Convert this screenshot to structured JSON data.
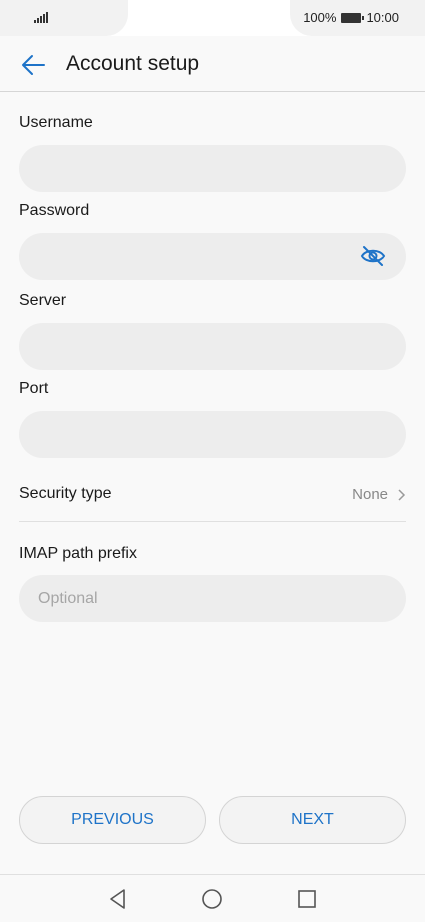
{
  "status_bar": {
    "battery": "100%",
    "time": "10:00"
  },
  "header": {
    "title": "Account setup",
    "back_icon": "arrow-left-icon"
  },
  "form": {
    "username_label": "Username",
    "username_value": "",
    "password_label": "Password",
    "password_value": "",
    "password_toggle_icon": "eye-off-icon",
    "server_label": "Server",
    "server_value": "",
    "port_label": "Port",
    "port_value": "",
    "security_label": "Security type",
    "security_value": "None",
    "imap_label": "IMAP path prefix",
    "imap_placeholder": "Optional"
  },
  "buttons": {
    "previous": "PREVIOUS",
    "next": "NEXT"
  },
  "nav": {
    "back_icon": "triangle-back-icon",
    "home_icon": "circle-home-icon",
    "recents_icon": "square-recents-icon"
  },
  "colors": {
    "accent": "#1e73c8",
    "field_bg": "#ededed",
    "page_bg": "#f9f9f9"
  }
}
